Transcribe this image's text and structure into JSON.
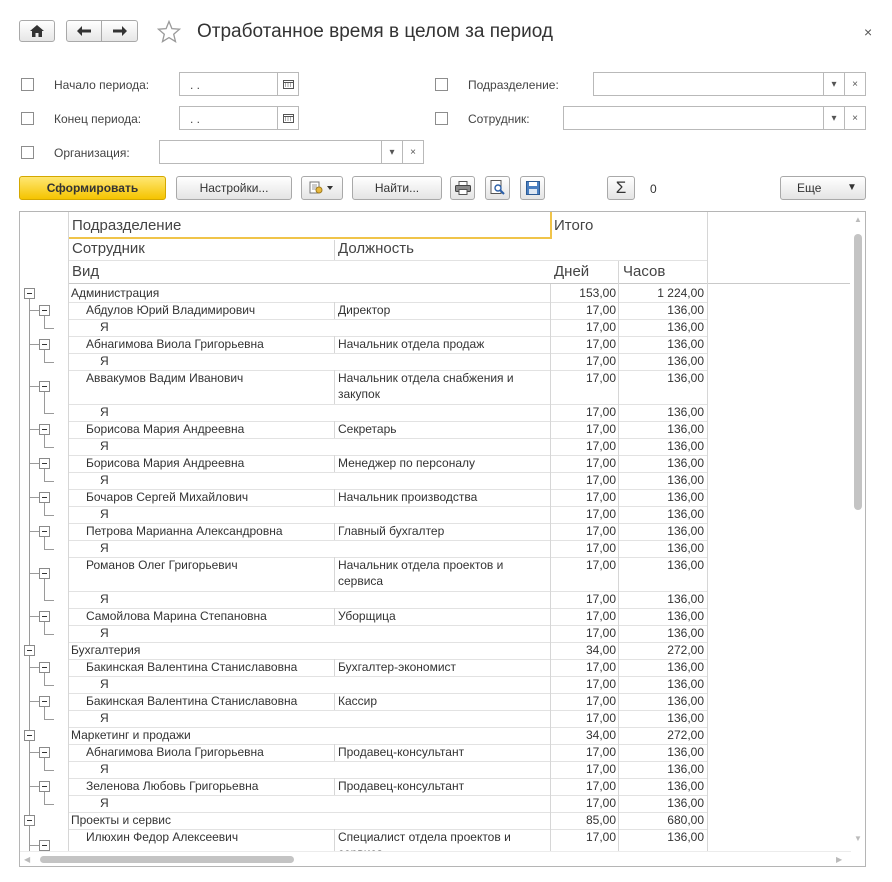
{
  "window": {
    "title": "Отработанное время в целом за период",
    "close_icon": "×"
  },
  "filters": {
    "start_label": "Начало периода:",
    "start_value": ".  .",
    "end_label": "Конец периода:",
    "end_value": ".  .",
    "org_label": "Организация:",
    "org_value": "",
    "dept_label": "Подразделение:",
    "dept_value": "",
    "emp_label": "Сотрудник:",
    "emp_value": ""
  },
  "toolbar": {
    "generate_label": "Сформировать",
    "settings_label": "Настройки...",
    "find_label": "Найти...",
    "sum_symbol": "Σ",
    "sum_value": "0",
    "more_label": "Еще"
  },
  "report": {
    "headers": {
      "group": "Подразделение",
      "total": "Итого",
      "employee": "Сотрудник",
      "position": "Должность",
      "kind": "Вид",
      "days": "Дней",
      "hours": "Часов"
    },
    "rows": [
      {
        "level": 0,
        "name": "Администрация",
        "position": "",
        "days": "153,00",
        "hours": "1 224,00"
      },
      {
        "level": 1,
        "name": "Абдулов Юрий Владимирович",
        "position": "Директор",
        "days": "17,00",
        "hours": "136,00"
      },
      {
        "level": 2,
        "name": "Я",
        "position": "",
        "days": "17,00",
        "hours": "136,00"
      },
      {
        "level": 1,
        "name": "Абнагимова Виола Григорьевна",
        "position": "Начальник отдела продаж",
        "days": "17,00",
        "hours": "136,00"
      },
      {
        "level": 2,
        "name": "Я",
        "position": "",
        "days": "17,00",
        "hours": "136,00"
      },
      {
        "level": 1,
        "name": "Аввакумов Вадим Иванович",
        "position": "Начальник отдела снабжения и",
        "position2": "закупок",
        "days": "17,00",
        "hours": "136,00"
      },
      {
        "level": 2,
        "name": "Я",
        "position": "",
        "days": "17,00",
        "hours": "136,00"
      },
      {
        "level": 1,
        "name": "Борисова Мария Андреевна",
        "position": "Секретарь",
        "days": "17,00",
        "hours": "136,00"
      },
      {
        "level": 2,
        "name": "Я",
        "position": "",
        "days": "17,00",
        "hours": "136,00"
      },
      {
        "level": 1,
        "name": "Борисова Мария Андреевна",
        "position": "Менеджер по персоналу",
        "days": "17,00",
        "hours": "136,00"
      },
      {
        "level": 2,
        "name": "Я",
        "position": "",
        "days": "17,00",
        "hours": "136,00"
      },
      {
        "level": 1,
        "name": "Бочаров Сергей Михайлович",
        "position": "Начальник производства",
        "days": "17,00",
        "hours": "136,00"
      },
      {
        "level": 2,
        "name": "Я",
        "position": "",
        "days": "17,00",
        "hours": "136,00"
      },
      {
        "level": 1,
        "name": "Петрова Марианна Александровна",
        "position": "Главный бухгалтер",
        "days": "17,00",
        "hours": "136,00"
      },
      {
        "level": 2,
        "name": "Я",
        "position": "",
        "days": "17,00",
        "hours": "136,00"
      },
      {
        "level": 1,
        "name": "Романов Олег Григорьевич",
        "position": "Начальник отдела проектов и",
        "position2": "сервиса",
        "days": "17,00",
        "hours": "136,00"
      },
      {
        "level": 2,
        "name": "Я",
        "position": "",
        "days": "17,00",
        "hours": "136,00"
      },
      {
        "level": 1,
        "name": "Самойлова Марина Степановна",
        "position": "Уборщица",
        "days": "17,00",
        "hours": "136,00"
      },
      {
        "level": 2,
        "name": "Я",
        "position": "",
        "days": "17,00",
        "hours": "136,00"
      },
      {
        "level": 0,
        "name": "Бухгалтерия",
        "position": "",
        "days": "34,00",
        "hours": "272,00"
      },
      {
        "level": 1,
        "name": "Бакинская Валентина Станиславовна",
        "position": "Бухгалтер-экономист",
        "days": "17,00",
        "hours": "136,00"
      },
      {
        "level": 2,
        "name": "Я",
        "position": "",
        "days": "17,00",
        "hours": "136,00"
      },
      {
        "level": 1,
        "name": "Бакинская Валентина Станиславовна",
        "position": "Кассир",
        "days": "17,00",
        "hours": "136,00"
      },
      {
        "level": 2,
        "name": "Я",
        "position": "",
        "days": "17,00",
        "hours": "136,00"
      },
      {
        "level": 0,
        "name": "Маркетинг и продажи",
        "position": "",
        "days": "34,00",
        "hours": "272,00"
      },
      {
        "level": 1,
        "name": "Абнагимова Виола Григорьевна",
        "position": "Продавец-консультант",
        "days": "17,00",
        "hours": "136,00"
      },
      {
        "level": 2,
        "name": "Я",
        "position": "",
        "days": "17,00",
        "hours": "136,00"
      },
      {
        "level": 1,
        "name": "Зеленова Любовь Григорьевна",
        "position": "Продавец-консультант",
        "days": "17,00",
        "hours": "136,00"
      },
      {
        "level": 2,
        "name": "Я",
        "position": "",
        "days": "17,00",
        "hours": "136,00"
      },
      {
        "level": 0,
        "name": "Проекты и сервис",
        "position": "",
        "days": "85,00",
        "hours": "680,00"
      },
      {
        "level": 1,
        "name": "Илюхин Федор Алексеевич",
        "position": "Специалист отдела проектов и",
        "position2": "сервиса",
        "days": "17,00",
        "hours": "136,00"
      }
    ]
  }
}
